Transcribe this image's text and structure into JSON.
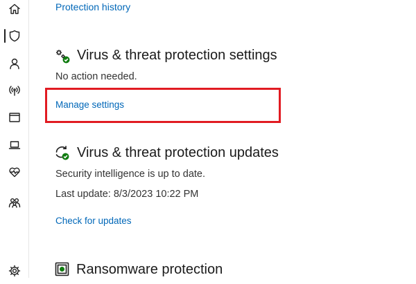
{
  "nav": {
    "items": [
      {
        "name": "home-icon",
        "active": false
      },
      {
        "name": "shield-icon",
        "active": true
      },
      {
        "name": "account-icon",
        "active": false
      },
      {
        "name": "network-icon",
        "active": false
      },
      {
        "name": "app-browser-icon",
        "active": false
      },
      {
        "name": "device-icon",
        "active": false
      },
      {
        "name": "health-icon",
        "active": false
      },
      {
        "name": "family-icon",
        "active": false
      },
      {
        "name": "settings-gear-icon",
        "active": false
      }
    ]
  },
  "protection_history": {
    "link": "Protection history"
  },
  "vt_settings": {
    "title": "Virus & threat protection settings",
    "status": "No action needed.",
    "link": "Manage settings",
    "icon": "settings-gears-check-icon",
    "highlight_color": "#e11b22"
  },
  "vt_updates": {
    "title": "Virus & threat protection updates",
    "status": "Security intelligence is up to date.",
    "last_update": "Last update: 8/3/2023 10:22 PM",
    "link": "Check for updates",
    "icon": "refresh-check-icon"
  },
  "ransomware": {
    "title": "Ransomware protection",
    "icon": "ransomware-shield-icon"
  },
  "colors": {
    "link": "#0067b8",
    "accent_green": "#107c10"
  }
}
